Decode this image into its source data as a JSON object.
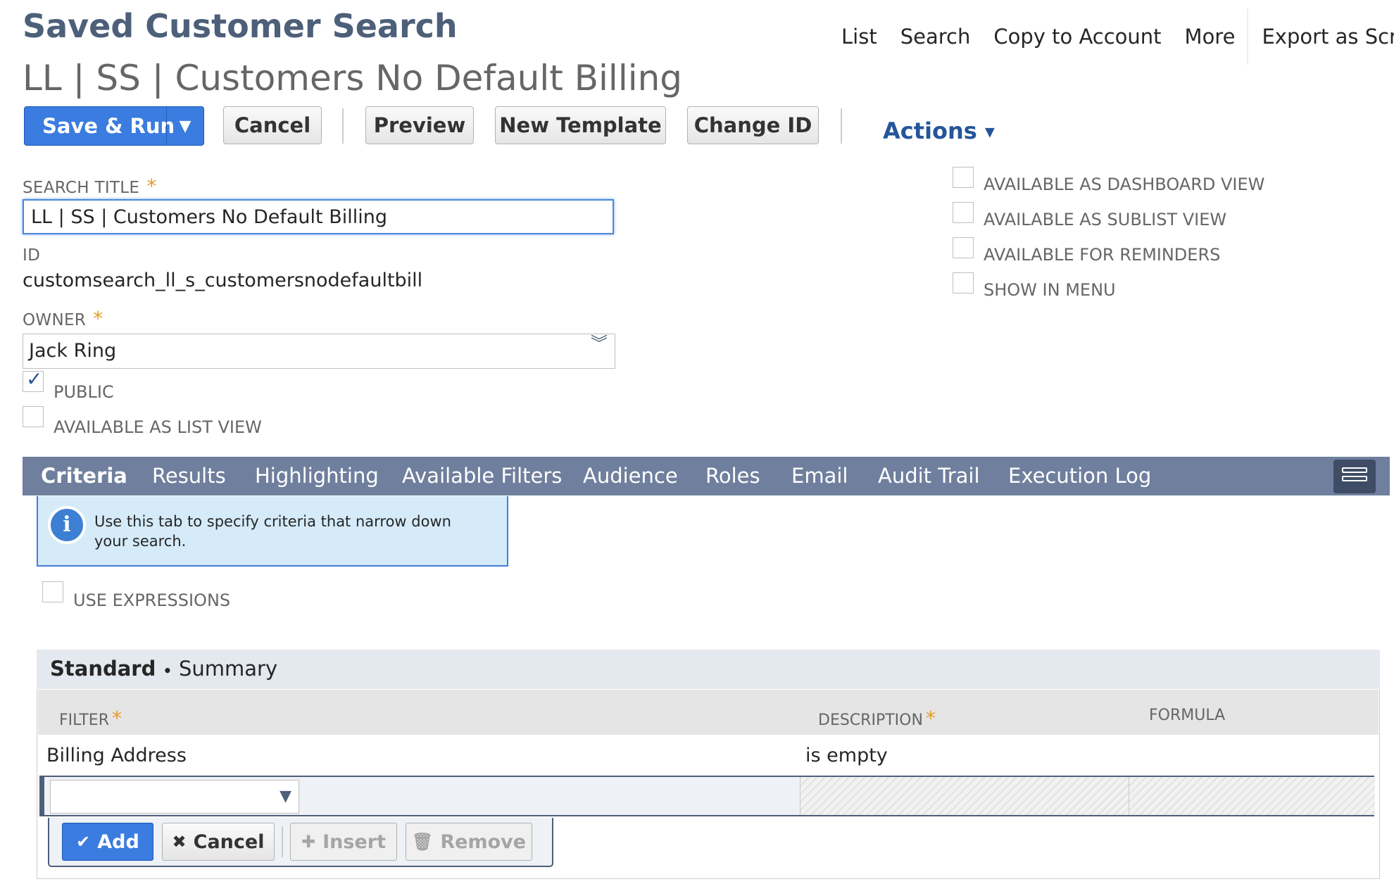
{
  "header": {
    "page_title": "Saved Customer Search",
    "record_title": "LL | SS | Customers No Default Billing",
    "nav": {
      "list": "List",
      "search": "Search",
      "copy_to_account": "Copy to Account",
      "more": "More",
      "export_as_script": "Export as Script"
    }
  },
  "toolbar": {
    "save_run": "Save & Run",
    "save_run_arrow": "▼",
    "cancel": "Cancel",
    "preview": "Preview",
    "new_template": "New Template",
    "change_id": "Change ID",
    "actions": "Actions"
  },
  "form": {
    "search_title_label": "SEARCH TITLE",
    "search_title_value": "LL | SS | Customers No Default Billing",
    "required_mark": "*",
    "id_label": "ID",
    "id_value": "customsearch_ll_s_customersnodefaultbill",
    "owner_label": "OWNER",
    "owner_value": "Jack Ring",
    "public_label": "PUBLIC",
    "public_checked": true,
    "list_view_label": "AVAILABLE AS LIST VIEW",
    "list_view_checked": false,
    "right_options": [
      {
        "label": "AVAILABLE AS DASHBOARD VIEW",
        "checked": false
      },
      {
        "label": "AVAILABLE AS SUBLIST VIEW",
        "checked": false
      },
      {
        "label": "AVAILABLE FOR REMINDERS",
        "checked": false
      },
      {
        "label": "SHOW IN MENU",
        "checked": false
      }
    ]
  },
  "subtabs": {
    "criteria": "Criteria",
    "results": "Results",
    "highlighting": "Highlighting",
    "available_filters": "Available Filters",
    "audience": "Audience",
    "roles": "Roles",
    "email": "Email",
    "audit_trail": "Audit Trail",
    "execution_log": "Execution Log",
    "active": "Criteria"
  },
  "criteria": {
    "info_text": "Use this tab to specify criteria that narrow down your search.",
    "use_expressions_label": "USE EXPRESSIONS",
    "use_expressions_checked": false,
    "inner_tabs": {
      "standard": "Standard",
      "standard_marker": "•",
      "summary": "Summary"
    },
    "columns": {
      "filter": "FILTER",
      "description": "DESCRIPTION",
      "formula": "FORMULA"
    },
    "rows": [
      {
        "filter": "Billing Address",
        "description": "is empty",
        "formula": ""
      }
    ],
    "edit_row_filter_value": "",
    "buttons": {
      "add": "Add",
      "cancel": "Cancel",
      "insert": "Insert",
      "remove": "Remove"
    }
  },
  "colors": {
    "primary_button": "#3b7ce0",
    "subtab_bar": "#6f7f9d",
    "title": "#4d5f79",
    "required": "#e49c2b",
    "info_bg": "#d5ebf9",
    "link": "#255599"
  }
}
